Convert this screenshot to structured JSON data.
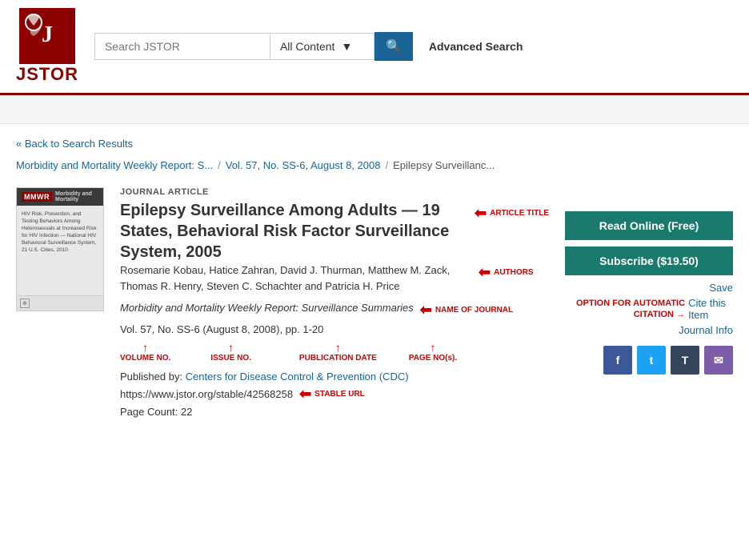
{
  "header": {
    "logo_text": "JSTOR",
    "search_placeholder": "Search JSTOR",
    "content_filter": "All Content",
    "advanced_search": "Advanced Search"
  },
  "navigation": {
    "back_link": "« Back to Search Results",
    "breadcrumb": [
      {
        "text": "Morbidity and Mortality Weekly Report: S...",
        "href": "#"
      },
      {
        "text": "Vol. 57, No. SS-6, August 8, 2008",
        "href": "#"
      },
      {
        "text": "Epilepsy Surveillanc...",
        "href": null
      }
    ]
  },
  "article": {
    "type": "Journal Article",
    "title": "Epilepsy Surveillance Among Adults — 19 States, Behavioral Risk Factor Surveillance System, 2005",
    "title_label": "ARTICLE TITLE",
    "authors": "Rosemarie Kobau, Hatice Zahran, David J. Thurman, Matthew M. Zack, Thomas R. Henry, Steven C. Schachter and Patricia H. Price",
    "authors_label": "AUTHORS",
    "journal_name": "Morbidity and Mortality Weekly Report: Surveillance Summaries",
    "journal_label": "NAME OF JOURNAL",
    "volume_info": "Vol. 57, No. SS-6 (August 8, 2008), pp. 1-20",
    "volume_label": "VOLUME NO.",
    "issue_label": "ISSUE NO.",
    "pub_date_label": "PUBLICATION DATE",
    "page_label": "PAGE NO(s).",
    "published_by": "Published by: ",
    "publisher_name": "Centers for Disease Control & Prevention (CDC)",
    "publisher_href": "#",
    "stable_url": "https://www.jstor.org/stable/42568258",
    "stable_url_label": "STABLE URL",
    "page_count": "Page Count: 22",
    "thumbnail_mmwr": "MMWR",
    "thumbnail_subtitle": "Morbidity and Mortality",
    "thumbnail_text_1": "HIV Risk, Prevention, and Testing Behaviors Among Heterosexuals at Increased Risk for HIV Infection — National HIV Behavioral Surveillance System,",
    "thumbnail_text_2": "21 U.S. Cities, 2010"
  },
  "actions": {
    "read_online": "Read Online (Free)",
    "subscribe": "Subscribe ($19.50)",
    "save": "Save",
    "option_for_auto_citation": "OPTION FOR AUTOMATIC CITATION →",
    "cite_this_item": "Cite this Item",
    "journal_info": "Journal Info"
  },
  "social": {
    "facebook": "f",
    "twitter": "t",
    "tumblr": "T",
    "email": "✉"
  }
}
